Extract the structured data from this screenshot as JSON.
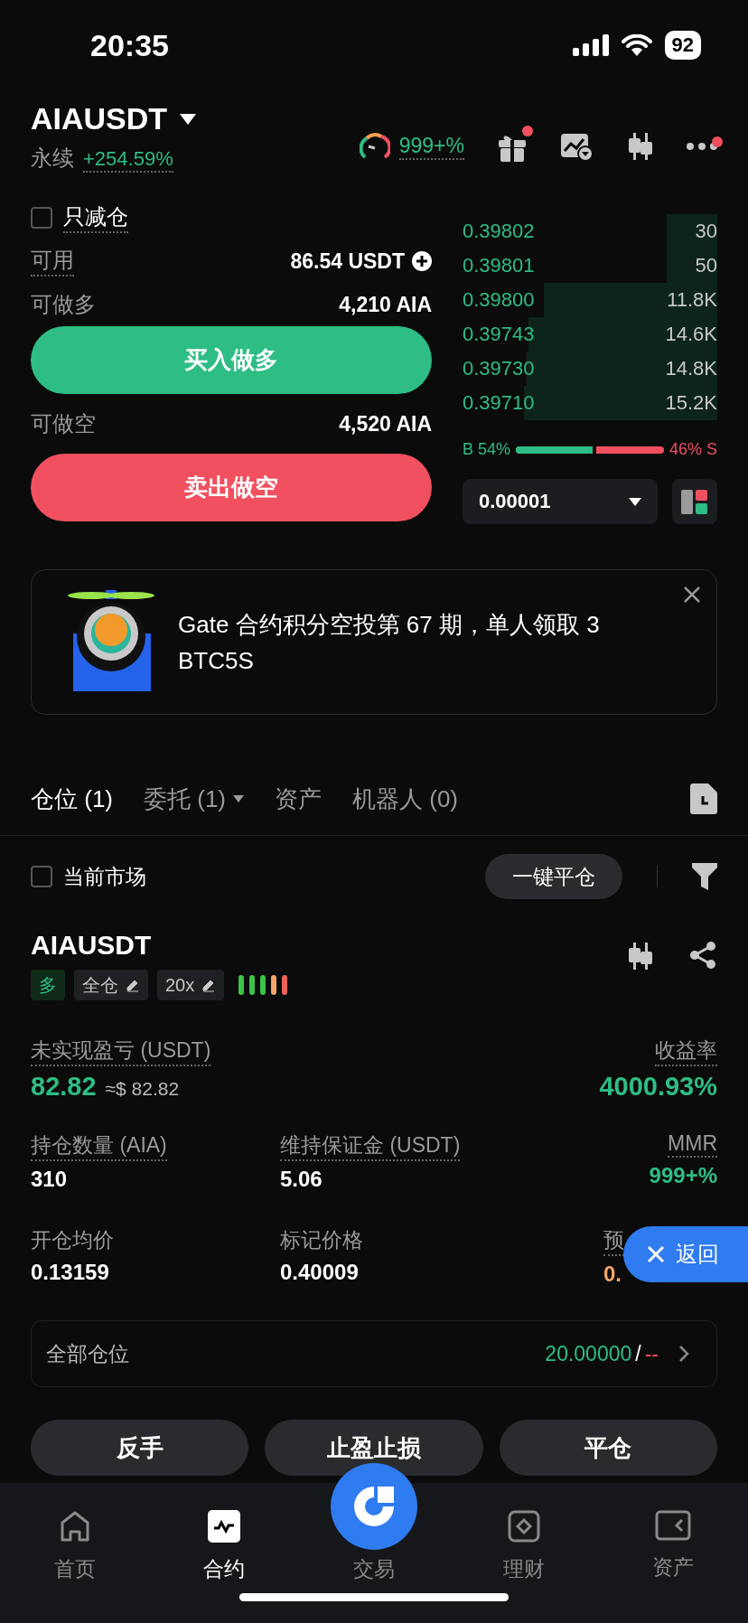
{
  "status_bar": {
    "time": "20:35",
    "battery": "92"
  },
  "header": {
    "symbol": "AIAUSDT",
    "type": "永续",
    "change": "+254.59%",
    "gauge_value": "999+%",
    "toolbar": [
      {
        "kind": "gift",
        "badge": true
      },
      {
        "kind": "chart",
        "badge": false
      },
      {
        "kind": "candles",
        "badge": false
      },
      {
        "kind": "more",
        "badge": true
      }
    ]
  },
  "order_form": {
    "reduce_only": {
      "label": "只减仓",
      "checked": false
    },
    "available": {
      "label": "可用",
      "value": "86.54 USDT"
    },
    "long": {
      "label": "可做多",
      "value": "4,210 AIA",
      "button": "买入做多"
    },
    "short": {
      "label": "可做空",
      "value": "4,520 AIA",
      "button": "卖出做空"
    }
  },
  "order_book": {
    "rows": [
      {
        "price": "0.39802",
        "size": "30"
      },
      {
        "price": "0.39801",
        "size": "50"
      },
      {
        "price": "0.39800",
        "size": "11.8K"
      },
      {
        "price": "0.39743",
        "size": "14.6K"
      },
      {
        "price": "0.39730",
        "size": "14.8K"
      },
      {
        "price": "0.39710",
        "size": "15.2K"
      }
    ],
    "buy_label": "B 54%",
    "sell_label": "46% S",
    "level": 0.54,
    "precision": "0.00001"
  },
  "banner": {
    "text": "Gate 合约积分空投第 67 期，单人领取 3 BTC5S"
  },
  "tabs": [
    {
      "label": "仓位 (1)",
      "selected": true,
      "dropdown": false
    },
    {
      "label": "委托 (1)",
      "selected": false,
      "dropdown": true
    },
    {
      "label": "资产",
      "selected": false,
      "dropdown": false
    },
    {
      "label": "机器人 (0)",
      "selected": false,
      "dropdown": false
    }
  ],
  "filter": {
    "label": "当前市场",
    "checked": false,
    "close_all": "一键平仓"
  },
  "position": {
    "symbol": "AIAUSDT",
    "side": "多",
    "margin_mode": "全仓",
    "leverage": "20x",
    "metrics": [
      [
        {
          "label": "未实现盈亏 (USDT)",
          "tooltip": true,
          "value": "82.82",
          "color": "#2ebd85",
          "note": "≈$ 82.82"
        },
        {
          "label": "收益率",
          "tooltip": true,
          "value": "4000.93%",
          "color": "#2ebd85"
        }
      ],
      [
        {
          "label": "持仓数量 (AIA)",
          "tooltip": true,
          "value": "310",
          "color": "#ffffff"
        },
        {
          "label": "维持保证金 (USDT)",
          "tooltip": true,
          "value": "5.06",
          "color": "#ffffff"
        },
        {
          "label": "MMR",
          "tooltip": true,
          "value": "999+%",
          "color": "#2ebd85"
        }
      ],
      [
        {
          "label": "开仓均价",
          "tooltip": false,
          "value": "0.13159",
          "color": "#ffffff"
        },
        {
          "label": "标记价格",
          "tooltip": false,
          "value": "0.40009",
          "color": "#ffffff"
        },
        {
          "label": "预",
          "tooltip": true,
          "value": "0.",
          "color": "#f5a46b",
          "covered": true
        }
      ]
    ],
    "all_positions": {
      "label": "全部仓位",
      "value": "20.00000",
      "separator": "/",
      "value_2": "--"
    },
    "actions": [
      "反手",
      "止盈止损",
      "平仓"
    ]
  },
  "floating_button": "返回",
  "bottom_nav": [
    {
      "kind": "home",
      "label": "首页",
      "selected": false
    },
    {
      "kind": "contract",
      "label": "合约",
      "selected": true
    },
    {
      "kind": "trade",
      "label": "交易",
      "selected": false
    },
    {
      "kind": "finance",
      "label": "理财",
      "selected": false
    },
    {
      "kind": "assets",
      "label": "资产",
      "selected": false
    }
  ]
}
